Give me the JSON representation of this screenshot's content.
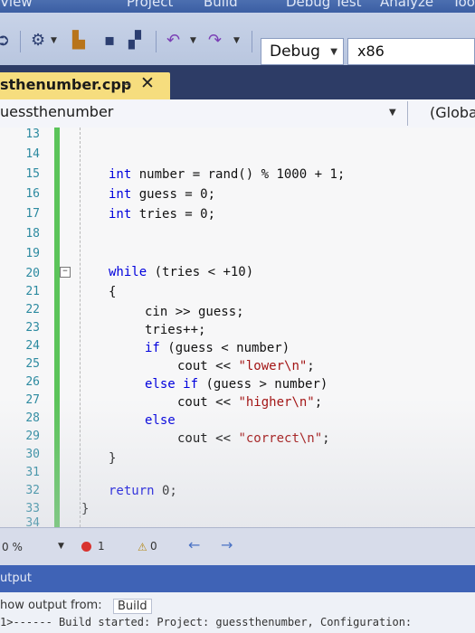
{
  "menu": {
    "items": [
      "View",
      "Project",
      "Build",
      "Debug",
      "Test",
      "Analyze",
      "Tools"
    ]
  },
  "toolbar": {
    "config_value": "Debug",
    "platform_value": "x86"
  },
  "tab": {
    "file_name": "sthenumber.cpp",
    "pin_glyph": "⊸",
    "close_glyph": "✕"
  },
  "navigation": {
    "scope": "uessthenumber",
    "member": "(Globa"
  },
  "editor": {
    "line_numbers": [
      "13",
      "14",
      "15",
      "16",
      "17",
      "18",
      "19",
      "20",
      "21",
      "22",
      "23",
      "24",
      "25",
      "26",
      "27",
      "28",
      "29",
      "30",
      "31",
      "32",
      "33",
      "34"
    ],
    "code": {
      "l15_type": "int",
      "l15_rest": " number = rand() % 1000 + 1;",
      "l16_type": "int",
      "l16_rest": " guess = 0;",
      "l17_type": "int",
      "l17_rest": " tries = 0;",
      "l20_kw": "while",
      "l20_rest": " (tries < +10)",
      "l21": "{",
      "l22": "cin >> guess;",
      "l23": "tries++;",
      "l24_kw": "if",
      "l24_rest": " (guess < number)",
      "l25_pre": "cout << ",
      "l25_str": "\"lower\\n\"",
      "l25_post": ";",
      "l26_kw": "else if",
      "l26_rest": " (guess > number)",
      "l27_pre": "cout << ",
      "l27_str": "\"higher\\n\"",
      "l27_post": ";",
      "l28_kw": "else",
      "l29_pre": "cout << ",
      "l29_str": "\"correct\\n\"",
      "l29_post": ";",
      "l30": "}",
      "l32_kw": "return",
      "l32_rest": " 0;",
      "l33": "}"
    }
  },
  "status": {
    "zoom": "0 %",
    "errors": "1",
    "warnings": "0"
  },
  "output": {
    "title": "utput",
    "show_from_label": "how output from:",
    "source": "Build",
    "log_line": "1>------ Build started: Project: guessthenumber, Configuration:"
  },
  "colors": {
    "accent": "#3f63b6",
    "tab_active": "#f6dd7e",
    "changebar": "#5bc45a",
    "keyword": "#0000dd",
    "string": "#a31515"
  }
}
